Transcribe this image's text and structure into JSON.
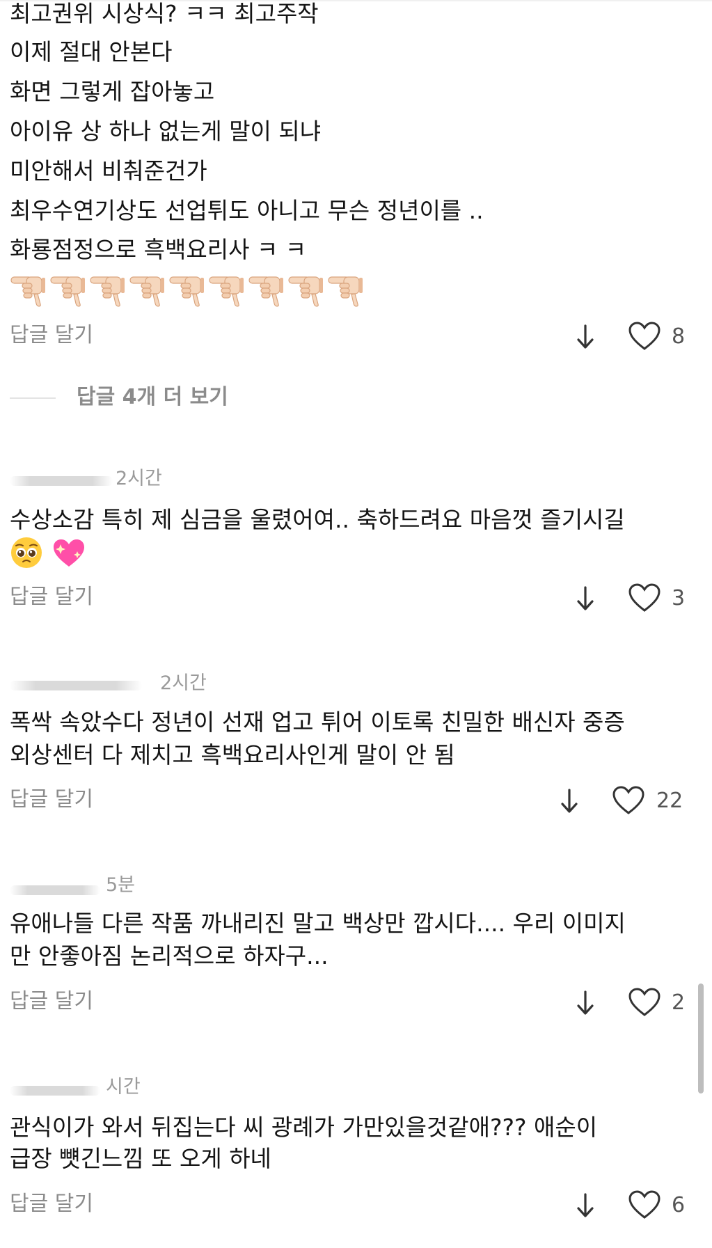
{
  "comments": [
    {
      "lines": [
        "최고권위 시상식? ㅋㅋ 최고주작",
        "이제 절대 안본다",
        "화면 그렇게 잡아놓고",
        "아이유 상 하나 없는게 말이 되냐",
        "미안해서 비춰준건가",
        "최우수연기상도 선업튀도 아니고 무슨 정년이를 ..",
        "화룡점정으로 흑백요리사 ㅋ ㅋ"
      ],
      "emoji_icons": [
        "thumbs-down-icon",
        "thumbs-down-icon",
        "thumbs-down-icon",
        "thumbs-down-icon",
        "thumbs-down-icon",
        "thumbs-down-icon",
        "thumbs-down-icon",
        "thumbs-down-icon",
        "thumbs-down-icon"
      ],
      "reply_label": "답글 달기",
      "likes": "8"
    },
    {
      "time": "2시간",
      "lines": [
        "수상소감 특히 제 심금을 울렸어여.. 축하드려요 마음껏 즐기시길"
      ],
      "emoji_icons": [
        "pleading-face-icon",
        "sparkling-heart-icon"
      ],
      "reply_label": "답글 달기",
      "likes": "3"
    },
    {
      "time": "2시간",
      "lines": [
        "폭싹 속았수다 정년이 선재 업고 튀어 이토록 친밀한 배신자 중증",
        "외상센터 다 제치고 흑백요리사인게 말이 안 됨"
      ],
      "reply_label": "답글 달기",
      "likes": "22"
    },
    {
      "time": "5분",
      "lines": [
        "유애나들 다른 작품 까내리진 말고 백상만 깝시다.... 우리 이미지",
        "만 안좋아짐 논리적으로 하자구..."
      ],
      "reply_label": "답글 달기",
      "likes": "2"
    },
    {
      "time": "시간",
      "lines": [
        "관식이가 와서 뒤집는다 씨 광례가 가만있을것같애??? 애순이",
        "급장 뻇긴느낌 또 오게 하네"
      ],
      "reply_label": "답글 달기",
      "likes": "6"
    }
  ],
  "view_more_replies": "답글 4개 더 보기",
  "colors": {
    "text": "#141414",
    "secondary": "#8b8b8b",
    "divider": "#e3e3e3"
  }
}
